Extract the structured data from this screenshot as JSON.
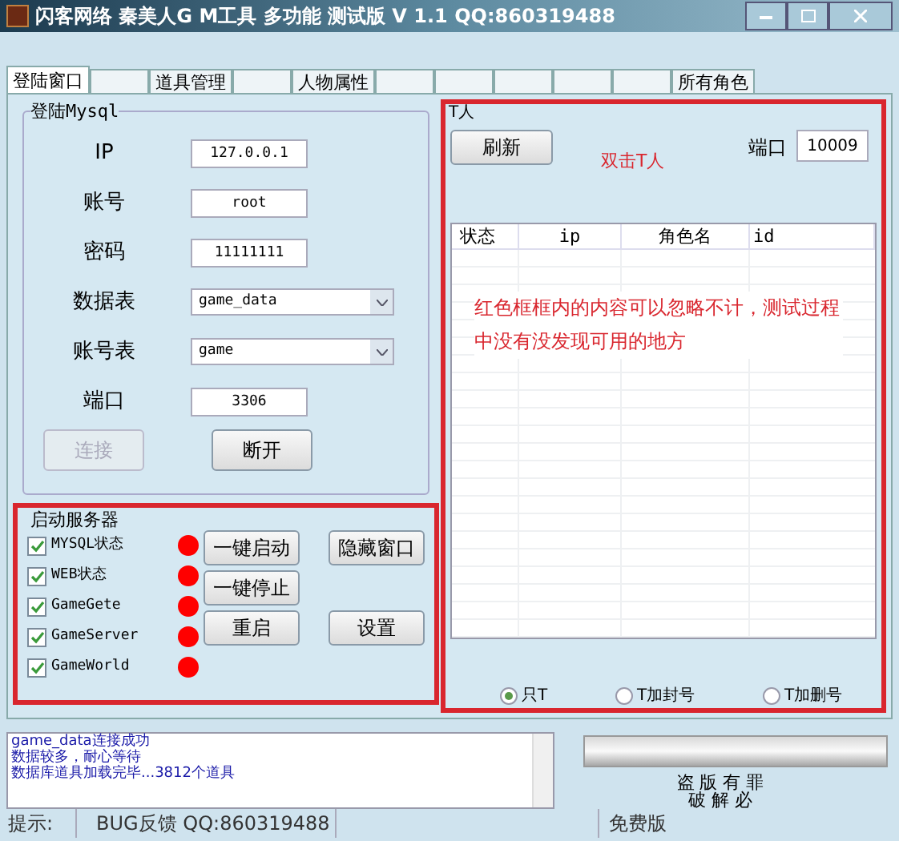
{
  "window": {
    "title": "闪客网络  秦美人G M工具 多功能 测试版 V 1.1  QQ:860319488"
  },
  "tabs": [
    {
      "label": "登陆窗口",
      "selected": true
    },
    {
      "selected": false
    },
    {
      "label": "道具管理",
      "selected": false
    },
    {
      "selected": false
    },
    {
      "label": "人物属性",
      "selected": false
    },
    {
      "selected": false
    },
    {
      "selected": false
    },
    {
      "selected": false
    },
    {
      "selected": false
    },
    {
      "selected": false
    },
    {
      "label": "所有角色",
      "selected": false
    }
  ],
  "login": {
    "title": "登陆Mysql",
    "fields": [
      {
        "label": "IP",
        "kind": "text",
        "value": "127.0.0.1"
      },
      {
        "label": "账号",
        "kind": "text",
        "value": "root"
      },
      {
        "label": "密码",
        "kind": "text",
        "value": "11111111"
      },
      {
        "label": "数据表",
        "kind": "select",
        "value": "game_data"
      },
      {
        "label": "账号表",
        "kind": "select",
        "value": "game"
      },
      {
        "label": "端口",
        "kind": "text",
        "value": "3306"
      }
    ],
    "buttons": [
      {
        "label": "连接",
        "disabled": true
      },
      {
        "label": "断开",
        "disabled": false
      }
    ]
  },
  "servers": {
    "title": "启动服务器",
    "items": [
      {
        "label": "MYSQL状态",
        "checked": true,
        "color": "#ff0000"
      },
      {
        "label": "WEB状态",
        "checked": true,
        "color": "#ff0000"
      },
      {
        "label": "GameGete",
        "checked": true,
        "color": "#ff0000"
      },
      {
        "label": "GameServer",
        "checked": true,
        "color": "#ff0000"
      },
      {
        "label": "GameWorld",
        "checked": true,
        "color": "#ff0000"
      }
    ],
    "buttons": [
      "一键启动",
      "隐藏窗口",
      "一键停止",
      "重启",
      "设置"
    ]
  },
  "kick": {
    "title": "T人",
    "refresh": "刷新",
    "hint": "双击T人",
    "port_label": "端口",
    "port": "10009",
    "columns": [
      "状态",
      "ip",
      "角色名",
      "id"
    ],
    "note": "红色框框内的内容可以忽略不计，测试过程中没有没发现可用的地方",
    "options": [
      {
        "label": "只T",
        "selected": true
      },
      {
        "label": "T加封号",
        "selected": false
      },
      {
        "label": "T加删号",
        "selected": false
      }
    ]
  },
  "progress": {
    "level": 1
  },
  "log": [
    "game_data连接成功",
    "数据较多，耐心等待",
    "数据库道具加载完毕...3812个道具"
  ],
  "notice": [
    "盗 版 有 罪",
    "破 解 必"
  ],
  "status_bar": [
    "提示:",
    "BUG反馈 QQ:860319488",
    "免费版"
  ]
}
